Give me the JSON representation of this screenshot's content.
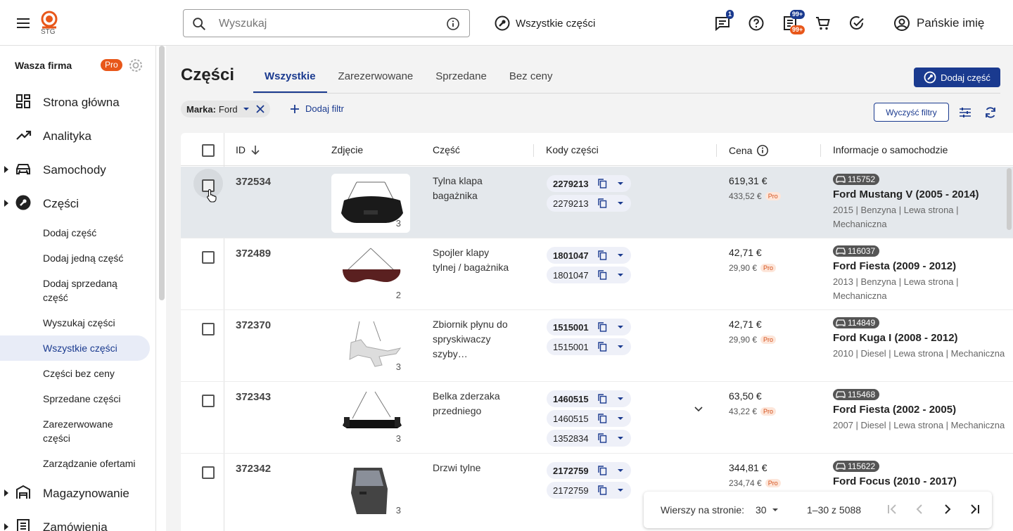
{
  "header": {
    "logo_text": "STG",
    "search_placeholder": "Wyszukaj",
    "all_parts_label": "Wszystkie części",
    "messages_badge": "1",
    "tasks_badge_top": "99+",
    "tasks_badge_bottom": "99+",
    "user_name": "Pańskie imię"
  },
  "sidebar": {
    "company": "Wasza firma",
    "pro_badge": "Pro",
    "items": [
      {
        "label": "Strona główna",
        "icon": "dashboard-icon"
      },
      {
        "label": "Analityka",
        "icon": "trending-up-icon"
      },
      {
        "label": "Samochody",
        "icon": "car-icon"
      },
      {
        "label": "Części",
        "icon": "wrench-icon"
      }
    ],
    "sub_items": [
      "Dodaj część",
      "Dodaj jedną część",
      "Dodaj sprzedaną część",
      "Wyszukaj części",
      "Wszystkie części",
      "Części bez ceny",
      "Sprzedane części",
      "Zarezerwowane części",
      "Zarządzanie ofertami"
    ],
    "items_bottom": [
      {
        "label": "Magazynowanie",
        "icon": "warehouse-icon"
      },
      {
        "label": "Zamówienia",
        "icon": "orders-icon"
      }
    ],
    "active_sub_item": "Wszystkie części"
  },
  "page": {
    "title": "Części",
    "tabs": [
      "Wszystkie",
      "Zarezerwowane",
      "Sprzedane",
      "Bez ceny"
    ],
    "active_tab": "Wszystkie",
    "add_part_button": "Dodaj część",
    "filter_chip_key": "Marka:",
    "filter_chip_value": "Ford",
    "add_filter_label": "Dodaj filtr",
    "clear_filters_label": "Wyczyść filtry"
  },
  "table": {
    "columns": [
      "ID",
      "Zdjęcie",
      "Część",
      "Kody części",
      "Cena",
      "Informacje o samochodzie"
    ],
    "rows": [
      {
        "id": "372534",
        "photo_count": "3",
        "part": "Tylna klapa bagażnika",
        "codes": [
          "2279213",
          "2279213"
        ],
        "price": "619,31 €",
        "price_pro": "433,52 €",
        "car_id": "115752",
        "car_name": "Ford Mustang V (2005 - 2014)",
        "car_info": "2015 | Benzyna | Lewa strona | Mechaniczna",
        "selected": true
      },
      {
        "id": "372489",
        "photo_count": "2",
        "part": "Spojler klapy tylnej / bagażnika",
        "codes": [
          "1801047",
          "1801047"
        ],
        "price": "42,71 €",
        "price_pro": "29,90 €",
        "car_id": "116037",
        "car_name": "Ford Fiesta (2009 - 2012)",
        "car_info": "2013 | Benzyna | Lewa strona | Mechaniczna"
      },
      {
        "id": "372370",
        "photo_count": "3",
        "part": "Zbiornik płynu do spryskiwaczy szyby…",
        "codes": [
          "1515001",
          "1515001"
        ],
        "price": "42,71 €",
        "price_pro": "29,90 €",
        "car_id": "114849",
        "car_name": "Ford Kuga I (2008 - 2012)",
        "car_info": "2010 | Diesel | Lewa strona | Mechaniczna"
      },
      {
        "id": "372343",
        "photo_count": "3",
        "part": "Belka zderzaka przedniego",
        "codes": [
          "1460515",
          "1460515",
          "1352834"
        ],
        "price": "63,50 €",
        "price_pro": "43,22 €",
        "car_id": "115468",
        "car_name": "Ford Fiesta (2002 - 2005)",
        "car_info": "2007 | Diesel | Lewa strona | Mechaniczna"
      },
      {
        "id": "372342",
        "photo_count": "3",
        "part": "Drzwi tylne",
        "codes": [
          "2172759",
          "2172759"
        ],
        "price": "344,81 €",
        "price_pro": "234,74 €",
        "car_id": "115622",
        "car_name": "Ford Focus (2010 - 2017)",
        "car_info": ""
      }
    ],
    "pro_tag": "Pro"
  },
  "pager": {
    "rows_label": "Wierszy na stronie:",
    "rows_value": "30",
    "range": "1–30 z 5088"
  },
  "colors": {
    "accent": "#1a3a8f",
    "brand": "#e8571a",
    "selected_row": "#e4e8ec"
  }
}
